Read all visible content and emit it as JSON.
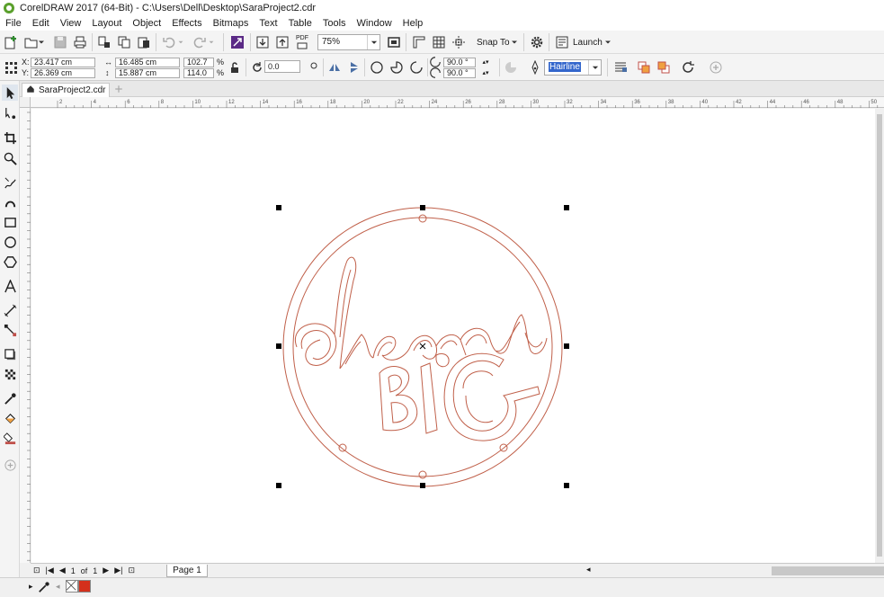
{
  "app": {
    "title": "CorelDRAW 2017 (64-Bit) - C:\\Users\\Dell\\Desktop\\SaraProject2.cdr",
    "logo_icon": "coreldraw-logo-icon",
    "accent": "#5aa02c"
  },
  "menu": [
    "File",
    "Edit",
    "View",
    "Layout",
    "Object",
    "Effects",
    "Bitmaps",
    "Text",
    "Table",
    "Tools",
    "Window",
    "Help"
  ],
  "toolbar": {
    "zoom": "75%",
    "snap_label": "Snap To",
    "launch_label": "Launch",
    "pdf_label": "PDF"
  },
  "property_bar": {
    "x_label": "X:",
    "y_label": "Y:",
    "x_value": "23.417 cm",
    "y_value": "26.369 cm",
    "width_value": "16.485 cm",
    "height_value": "15.887 cm",
    "scale_x": "102.7",
    "scale_y": "114.0",
    "percent": "%",
    "rotation": "0.0",
    "angle_start": "90.0 °",
    "angle_end": "90.0 °",
    "outline": "Hairline"
  },
  "document": {
    "tab_name": "SaraProject2.cdr",
    "ruler_ticks": [
      "2",
      "4",
      "6",
      "8",
      "10",
      "12",
      "14",
      "16",
      "18",
      "20",
      "22",
      "24",
      "26",
      "28",
      "30",
      "32",
      "34",
      "36",
      "38",
      "40",
      "42",
      "44",
      "46",
      "48",
      "50"
    ]
  },
  "artwork": {
    "stroke_color": "#c0604a",
    "handle_color": "#000000"
  },
  "page_nav": {
    "current": "1",
    "of": "of",
    "total": "1",
    "page_tab": "Page 1"
  },
  "palette": {
    "fill_color": "#d4301c"
  }
}
